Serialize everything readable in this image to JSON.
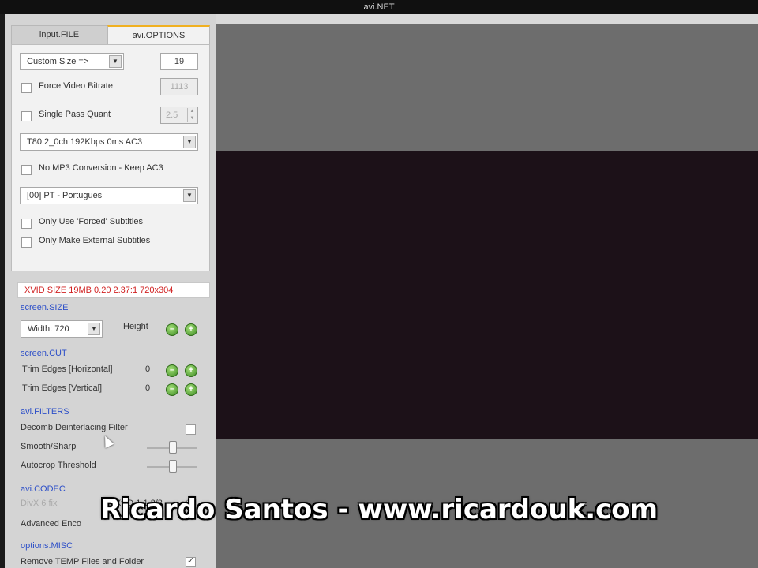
{
  "window": {
    "title": "avi.NET"
  },
  "tabs": [
    {
      "label": "input.FILE",
      "active": false
    },
    {
      "label": "avi.OPTIONS",
      "active": true
    }
  ],
  "options": {
    "size_select": "Custom Size =>",
    "size_value": "19",
    "force_bitrate_label": "Force Video Bitrate",
    "force_bitrate_value": "1113",
    "single_pass_label": "Single Pass Quant",
    "single_pass_value": "2.5",
    "audio_select": "T80 2_0ch 192Kbps 0ms AC3",
    "no_mp3_label": "No MP3 Conversion - Keep AC3",
    "subtitle_select": "[00] PT - Portugues",
    "forced_subs_label": "Only Use 'Forced' Subtitles",
    "external_subs_label": "Only Make External Subtitles"
  },
  "size_info": "XVID SIZE 19MB 0.20 2.37:1 720x304",
  "screen_size": {
    "section": "screen.SIZE",
    "width_select": "Width: 720",
    "height_label": "Height"
  },
  "screen_cut": {
    "section": "screen.CUT",
    "trim_h_label": "Trim Edges [Horizontal]",
    "trim_h_value": "0",
    "trim_v_label": "Trim Edges [Vertical]",
    "trim_v_value": "0"
  },
  "filters": {
    "section": "avi.FILTERS",
    "decomb_label": "Decomb Deinterlacing Filter",
    "smooth_label": "Smooth/Sharp",
    "autocrop_label": "Autocrop Threshold"
  },
  "codec": {
    "section": "avi.CODEC",
    "divx_label": "DivX 6 fix",
    "xvid_label": "XviD 1.1.2/3",
    "advanced_label": "Advanced Enco"
  },
  "misc": {
    "section": "options.MISC",
    "remove_temp_label": "Remove TEMP Files and Folder"
  },
  "overlay": {
    "caption": "Ricardo Santos - www.ricardouk.com"
  },
  "colors": {
    "warning_text": "#d02020",
    "section_text": "#2d4fc8",
    "active_tab_accent": "#f0b020"
  }
}
